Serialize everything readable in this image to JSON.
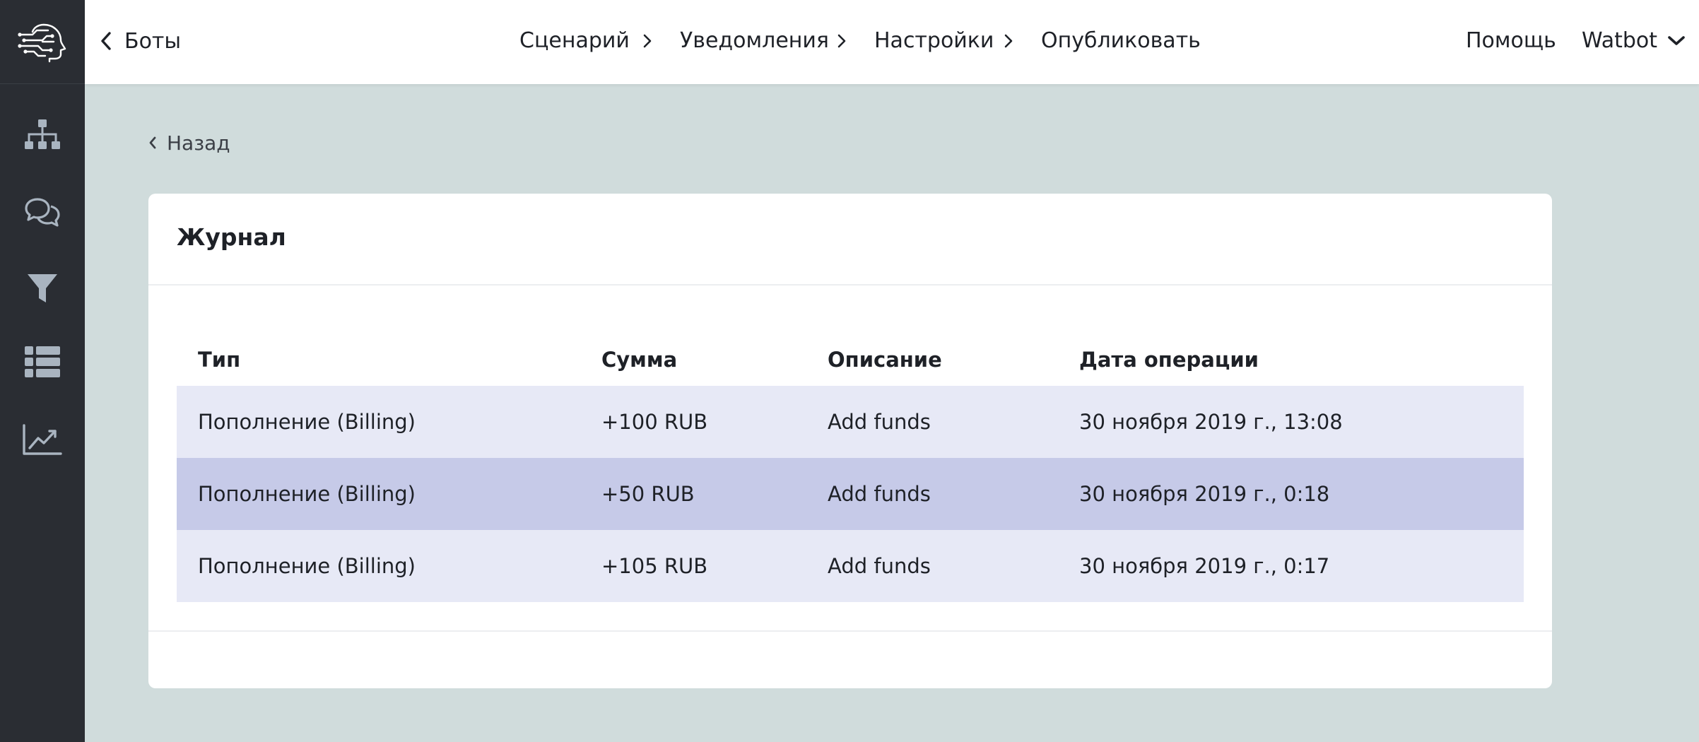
{
  "sidebar": {
    "logo_icon": "head-circuit-logo",
    "items": [
      {
        "icon": "hierarchy-icon"
      },
      {
        "icon": "chat-bubbles-icon"
      },
      {
        "icon": "funnel-icon"
      },
      {
        "icon": "list-icon"
      },
      {
        "icon": "chart-icon"
      }
    ]
  },
  "topbar": {
    "back_label": "Боты",
    "steps": [
      "Сценарий",
      "Уведомления",
      "Настройки",
      "Опубликовать"
    ],
    "help_label": "Помощь",
    "user_label": "Watbot"
  },
  "page": {
    "back_label": "Назад",
    "card_title": "Журнал"
  },
  "table": {
    "headers": [
      "Тип",
      "Сумма",
      "Описание",
      "Дата операции"
    ],
    "rows": [
      {
        "type": "Пополнение (Billing)",
        "amount": "+100 RUB",
        "description": "Add funds",
        "date": "30 ноября 2019 г., 13:08"
      },
      {
        "type": "Пополнение (Billing)",
        "amount": "+50 RUB",
        "description": "Add funds",
        "date": "30 ноября 2019 г., 0:18"
      },
      {
        "type": "Пополнение (Billing)",
        "amount": "+105 RUB",
        "description": "Add funds",
        "date": "30 ноября 2019 г., 0:17"
      }
    ]
  },
  "colors": {
    "sidebar_bg": "#2a2d33",
    "page_bg": "#d0dcdc",
    "row_light": "#e7e9f6",
    "row_selected": "#c6cae8",
    "icon_color": "#a9b4c0"
  }
}
